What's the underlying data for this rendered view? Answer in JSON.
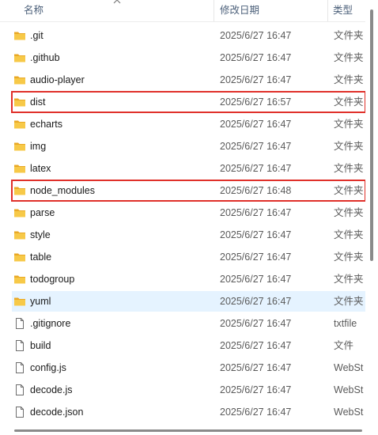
{
  "header": {
    "name_label": "名称",
    "date_label": "修改日期",
    "type_label": "类型"
  },
  "files": [
    {
      "name": ".git",
      "date": "2025/6/27 16:47",
      "type": "文件夹",
      "icon": "folder-icon"
    },
    {
      "name": ".github",
      "date": "2025/6/27 16:47",
      "type": "文件夹",
      "icon": "folder-icon"
    },
    {
      "name": "audio-player",
      "date": "2025/6/27 16:47",
      "type": "文件夹",
      "icon": "folder-icon"
    },
    {
      "name": "dist",
      "date": "2025/6/27 16:57",
      "type": "文件夹",
      "icon": "folder-icon",
      "highlighted": true
    },
    {
      "name": "echarts",
      "date": "2025/6/27 16:47",
      "type": "文件夹",
      "icon": "folder-icon"
    },
    {
      "name": "img",
      "date": "2025/6/27 16:47",
      "type": "文件夹",
      "icon": "folder-icon"
    },
    {
      "name": "latex",
      "date": "2025/6/27 16:47",
      "type": "文件夹",
      "icon": "folder-icon"
    },
    {
      "name": "node_modules",
      "date": "2025/6/27 16:48",
      "type": "文件夹",
      "icon": "folder-icon",
      "highlighted": true
    },
    {
      "name": "parse",
      "date": "2025/6/27 16:47",
      "type": "文件夹",
      "icon": "folder-icon"
    },
    {
      "name": "style",
      "date": "2025/6/27 16:47",
      "type": "文件夹",
      "icon": "folder-icon"
    },
    {
      "name": "table",
      "date": "2025/6/27 16:47",
      "type": "文件夹",
      "icon": "folder-icon"
    },
    {
      "name": "todogroup",
      "date": "2025/6/27 16:47",
      "type": "文件夹",
      "icon": "folder-icon"
    },
    {
      "name": "yuml",
      "date": "2025/6/27 16:47",
      "type": "文件夹",
      "icon": "folder-icon",
      "hovered": true
    },
    {
      "name": ".gitignore",
      "date": "2025/6/27 16:47",
      "type": "txtfile",
      "icon": "file-icon"
    },
    {
      "name": "build",
      "date": "2025/6/27 16:47",
      "type": "文件",
      "icon": "file-icon"
    },
    {
      "name": "config.js",
      "date": "2025/6/27 16:47",
      "type": "WebSt",
      "icon": "file-icon"
    },
    {
      "name": "decode.js",
      "date": "2025/6/27 16:47",
      "type": "WebSt",
      "icon": "file-icon"
    },
    {
      "name": "decode.json",
      "date": "2025/6/27 16:47",
      "type": "WebSt",
      "icon": "file-icon"
    }
  ],
  "colors": {
    "highlight_border": "#e0302a",
    "hover_background": "#e5f3ff",
    "folder": "#f5c243",
    "header_text": "#4c607a"
  }
}
